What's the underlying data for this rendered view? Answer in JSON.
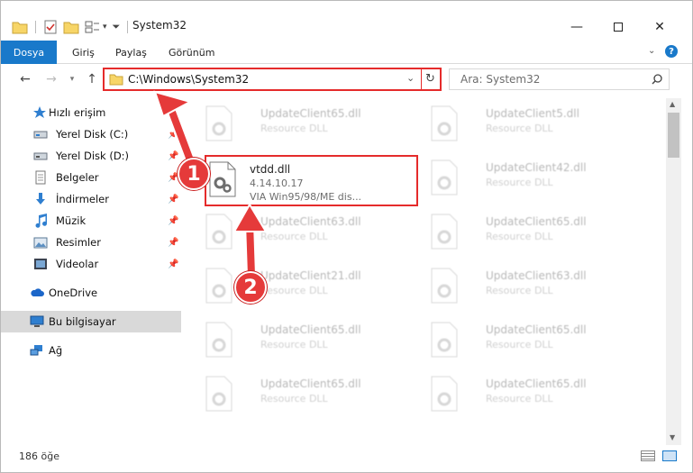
{
  "window": {
    "title": "System32"
  },
  "ribbon": {
    "tabs": [
      "Dosya",
      "Giriş",
      "Paylaş",
      "Görünüm"
    ]
  },
  "address": {
    "path": "C:\\Windows\\System32"
  },
  "search": {
    "placeholder": "Ara: System32"
  },
  "nav": {
    "items": [
      {
        "label": "Hızlı erişim",
        "icon": "star-icon"
      },
      {
        "label": "Yerel Disk (C:)",
        "icon": "drive-icon"
      },
      {
        "label": "Yerel Disk (D:)",
        "icon": "drive-icon"
      },
      {
        "label": "Belgeler",
        "icon": "documents-icon"
      },
      {
        "label": "İndirmeler",
        "icon": "download-icon"
      },
      {
        "label": "Müzik",
        "icon": "music-icon"
      },
      {
        "label": "Resimler",
        "icon": "pictures-icon"
      },
      {
        "label": "Videolar",
        "icon": "video-icon"
      },
      {
        "label": "OneDrive",
        "icon": "cloud-icon"
      },
      {
        "label": "Bu bilgisayar",
        "icon": "computer-icon"
      },
      {
        "label": "Ağ",
        "icon": "network-icon"
      }
    ]
  },
  "files": [
    {
      "name": "UpdateClient65.dll",
      "sub": "Resource DLL"
    },
    {
      "name": "UpdateClient5.dll",
      "sub": "Resource DLL"
    },
    {
      "name": "vtdd.dll",
      "sub": "4.14.10.17",
      "sub2": "VIA Win95/98/ME dis..."
    },
    {
      "name": "UpdateClient42.dll",
      "sub": "Resource DLL"
    },
    {
      "name": "UpdateClient63.dll",
      "sub": "Resource DLL"
    },
    {
      "name": "UpdateClient65.dll",
      "sub": "Resource DLL"
    },
    {
      "name": "UpdateClient21.dll",
      "sub": "Resource DLL"
    },
    {
      "name": "UpdateClient63.dll",
      "sub": "Resource DLL"
    },
    {
      "name": "UpdateClient65.dll",
      "sub": "Resource DLL"
    },
    {
      "name": "UpdateClient65.dll",
      "sub": "Resource DLL"
    },
    {
      "name": "UpdateClient65.dll",
      "sub": "Resource DLL"
    },
    {
      "name": "UpdateClient65.dll",
      "sub": "Resource DLL"
    }
  ],
  "status": {
    "count": "186 öğe"
  },
  "markers": [
    "1",
    "2"
  ],
  "colors": {
    "accent": "#1979ca",
    "highlight": "#e52b2b",
    "marker": "#e53a3a"
  }
}
